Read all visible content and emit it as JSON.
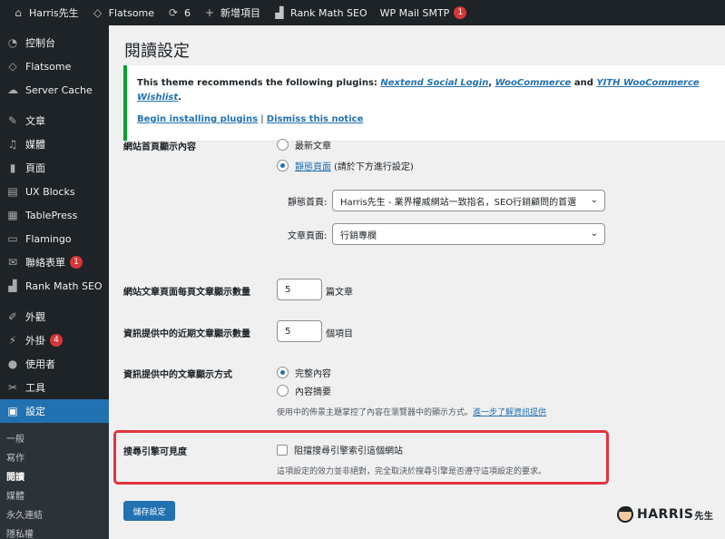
{
  "adminbar": {
    "site": "Harris先生",
    "theme": "Flatsome",
    "updates": "6",
    "new_item": "新增項目",
    "rankmath": "Rank Math SEO",
    "wpmail": "WP Mail SMTP",
    "wpmail_badge": "1"
  },
  "sidebar": {
    "items": [
      {
        "label": "控制台",
        "icon": "dashboard-icon"
      },
      {
        "label": "Flatsome",
        "icon": "flatsome-icon"
      },
      {
        "label": "Server Cache",
        "icon": "cloud-icon"
      },
      {
        "label": "文章",
        "icon": "pin-icon"
      },
      {
        "label": "媒體",
        "icon": "media-icon"
      },
      {
        "label": "頁面",
        "icon": "page-icon"
      },
      {
        "label": "UX Blocks",
        "icon": "blocks-icon"
      },
      {
        "label": "TablePress",
        "icon": "table-icon"
      },
      {
        "label": "Flamingo",
        "icon": "flamingo-icon"
      },
      {
        "label": "聯絡表單",
        "icon": "mail-icon",
        "badge": "1"
      },
      {
        "label": "Rank Math SEO",
        "icon": "chart-icon"
      },
      {
        "label": "外觀",
        "icon": "brush-icon"
      },
      {
        "label": "外掛",
        "icon": "plugin-icon",
        "badge": "4"
      },
      {
        "label": "使用者",
        "icon": "user-icon"
      },
      {
        "label": "工具",
        "icon": "wrench-icon"
      },
      {
        "label": "設定",
        "icon": "settings-icon"
      }
    ],
    "submenu": [
      "一般",
      "寫作",
      "閱讀",
      "媒體",
      "永久連結",
      "隱私權"
    ]
  },
  "page": {
    "title": "閱讀設定"
  },
  "notice": {
    "text_prefix": "This theme recommends the following plugins: ",
    "plugin1": "Nextend Social Login",
    "sep1": ", ",
    "plugin2": "WooCommerce",
    "sep2": " and ",
    "plugin3": "YITH WooCommerce Wishlist",
    "text_suffix": ".",
    "begin": "Begin installing plugins",
    "divider": " | ",
    "dismiss": "Dismiss this notice"
  },
  "homepage": {
    "label": "網站首頁顯示內容",
    "option1": "最新文章",
    "option2_link": "靜態頁面",
    "option2_note": "(請於下方進行設定)",
    "static_label": "靜態首頁:",
    "static_value": "Harris先生 - 業界權威網站一致指名，SEO行銷顧問的首選",
    "posts_label": "文章頁面:",
    "posts_value": "行銷專欄"
  },
  "posts_per_page": {
    "label": "網站文章頁面每頁文章顯示數量",
    "value": "5",
    "unit": "篇文章"
  },
  "feed_count": {
    "label": "資訊提供中的近期文章顯示數量",
    "value": "5",
    "unit": "個項目"
  },
  "feed_display": {
    "label": "資訊提供中的文章顯示方式",
    "option1": "完整內容",
    "option2": "內容摘要",
    "desc": "使用中的佈景主題掌控了內容在瀏覽器中的顯示方式。",
    "desc_link": "進一步了解資訊提供"
  },
  "visibility": {
    "label": "搜尋引擎可見度",
    "checkbox": "阻擋搜尋引擎索引這個網站",
    "desc": "這項設定的效力並非絕對，完全取決於搜尋引擎是否遵守這項設定的要求。"
  },
  "save": "儲存設定",
  "brand": {
    "main": "HARRIS",
    "suffix": "先生"
  },
  "colors": {
    "accent": "#2271b1",
    "highlight": "#e1343f",
    "notice_border": "#00a32a"
  }
}
